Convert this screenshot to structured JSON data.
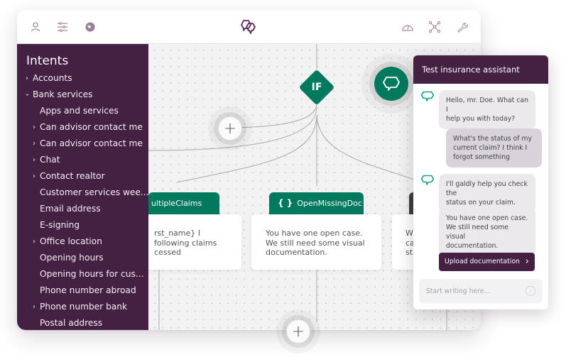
{
  "topbar": {
    "left_icons": [
      "user-icon",
      "sliders-icon",
      "globe-icon"
    ],
    "logo": "chat-bubbles-logo",
    "right_icons": [
      "dashboard-gauge-icon",
      "network-icon",
      "wrench-icon"
    ]
  },
  "sidebar": {
    "title": "Intents",
    "items": [
      {
        "label": "Accounts",
        "level": 0,
        "chevron": "›"
      },
      {
        "label": "Bank services",
        "level": 0,
        "chevron": "›",
        "expanded": true
      },
      {
        "label": "Apps and services",
        "level": 1,
        "chevron": ""
      },
      {
        "label": "Can advisor contact me",
        "level": 1,
        "chevron": "›"
      },
      {
        "label": "Can advisor contact me",
        "level": 1,
        "chevron": "›"
      },
      {
        "label": "Chat",
        "level": 1,
        "chevron": "›"
      },
      {
        "label": "Contact realtor",
        "level": 1,
        "chevron": "›"
      },
      {
        "label": "Customer services wee...",
        "level": 1,
        "chevron": ""
      },
      {
        "label": "Email address",
        "level": 1,
        "chevron": ""
      },
      {
        "label": "E-signing",
        "level": 1,
        "chevron": ""
      },
      {
        "label": "Office location",
        "level": 1,
        "chevron": "›"
      },
      {
        "label": "Opening hours",
        "level": 1,
        "chevron": ""
      },
      {
        "label": "Opening hours for cus...",
        "level": 1,
        "chevron": ""
      },
      {
        "label": "Phone number abroad",
        "level": 1,
        "chevron": ""
      },
      {
        "label": "Phone number bank",
        "level": 1,
        "chevron": "›"
      },
      {
        "label": "Postal address",
        "level": 1,
        "chevron": ""
      }
    ]
  },
  "canvas": {
    "if_label": "IF",
    "plus_symbol": "+",
    "nodes": [
      {
        "tag": "MultipleClaims",
        "tag_visible": "ultipleClaims",
        "color": "#007a5e",
        "text": "rst_name} I\nfollowing claims\ncessed"
      },
      {
        "tag": "OpenMissingDoc",
        "braces": "{ }",
        "color": "#007a5e",
        "text": "You have one open case.\nWe still need some visual\ndocumentation."
      },
      {
        "tag": "",
        "braces": "{ }",
        "color": "#3d3d3d",
        "text": "We cou\ncases t\nstatus"
      }
    ]
  },
  "chat": {
    "title": "Test insurance assistant",
    "messages": [
      {
        "from": "bot",
        "text": "Hello, mr. Doe. What can I\nhelp you with today?"
      },
      {
        "from": "user",
        "text": "What's the status of my\ncurrent claim? I think I\nforgot something"
      },
      {
        "from": "bot",
        "text": "I'll galdly help you check the\nstatus on your claim."
      },
      {
        "from": "bot",
        "text": "You have one open case.\nWe still need some visual\ndocumentation."
      }
    ],
    "action_button": "Upload documentation",
    "action_arrow": "›",
    "input_placeholder": "Start writing here...",
    "send_symbol": "›"
  },
  "colors": {
    "brand_purple": "#442143",
    "node_green": "#007a5e",
    "node_dark": "#3d3d3d"
  }
}
